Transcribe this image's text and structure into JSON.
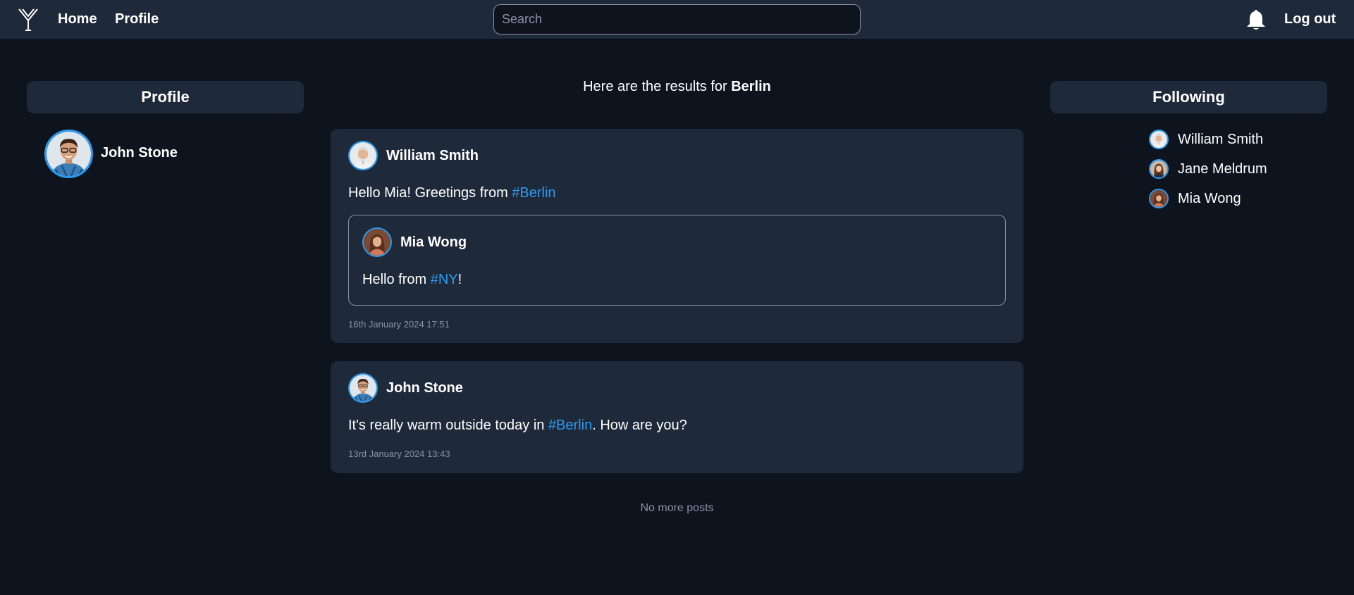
{
  "nav": {
    "home_label": "Home",
    "profile_label": "Profile",
    "search_placeholder": "Search",
    "search_value": "",
    "logout_label": "Log out"
  },
  "profile_panel": {
    "title": "Profile",
    "user_name": "John Stone"
  },
  "results": {
    "prefix": "Here are the results for ",
    "query": "Berlin"
  },
  "posts": [
    {
      "author": "William Smith",
      "text_before": "Hello Mia! Greetings from ",
      "hashtag": "#Berlin",
      "text_after": "",
      "quote": {
        "author": "Mia Wong",
        "text_before": "Hello from ",
        "hashtag": "#NY",
        "text_after": "!"
      },
      "timestamp": "16th January 2024 17:51"
    },
    {
      "author": "John Stone",
      "text_before": "It's really warm outside today in ",
      "hashtag": "#Berlin",
      "text_after": ". How are you?",
      "timestamp": "13rd January 2024 13:43"
    }
  ],
  "end_message": "No more posts",
  "following_panel": {
    "title": "Following",
    "users": [
      {
        "name": "William Smith",
        "avatar": "avatar-william"
      },
      {
        "name": "Jane Meldrum",
        "avatar": "avatar-jane"
      },
      {
        "name": "Mia Wong",
        "avatar": "avatar-mia"
      }
    ]
  },
  "colors": {
    "background": "#0d141e",
    "surface": "#1e293a",
    "accent": "#2b9bf0",
    "muted": "#8a93a3"
  }
}
